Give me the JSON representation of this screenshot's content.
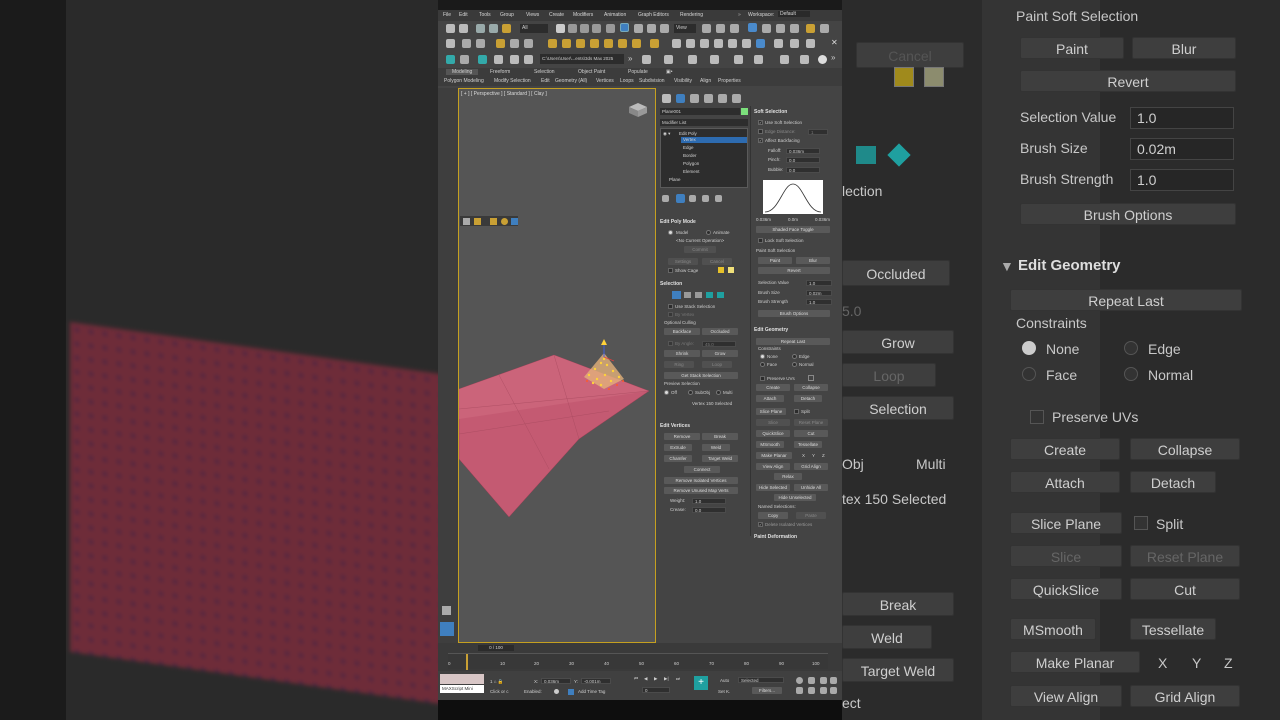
{
  "app": {
    "workspace_label": "Workspace:",
    "workspace_value": "Default",
    "menus": [
      "File",
      "Edit",
      "Tools",
      "Group",
      "Views",
      "Create",
      "Modifiers",
      "Animation",
      "Graph Editors",
      "Rendering"
    ],
    "path": "C:\\Users\\User\\...ents\\3ds Max 2025",
    "view_dropdown": "View",
    "all_dropdown": "All",
    "ribbon_tabs": [
      "Modeling",
      "Freeform",
      "Selection",
      "Object Paint",
      "Populate"
    ],
    "ribbon_sub": [
      "Polygon Modeling",
      "Modify Selection",
      "Edit",
      "Geometry (All)",
      "Vertices",
      "Loops",
      "Subdivision",
      "Visibility",
      "Align",
      "Properties"
    ]
  },
  "viewport": {
    "label": "[ + ] [ Perspective ] [ Standard ] [ Clay ]"
  },
  "modify": {
    "object_name": "Plane001",
    "modifier_list": "Modifier List",
    "stack": [
      "Edit Poly",
      "Vertex",
      "Edge",
      "Border",
      "Polygon",
      "Element",
      "Plane"
    ],
    "edit_poly_mode": {
      "title": "Edit Poly Mode",
      "model": "Model",
      "animate": "Animate",
      "no_op": "<No Current Operation>",
      "commit": "Commit",
      "settings": "Settings",
      "cancel": "Cancel",
      "show_cage": "Show Cage"
    },
    "selection": {
      "title": "Selection",
      "use_stack": "Use Stack Selection",
      "by_vertex": "By Vertex",
      "ignore_backfacing": "Ignore Backfacing",
      "optional_culling": "Optional Culling",
      "backface": "Backface",
      "occluded": "Occluded",
      "by_angle": "By Angle:",
      "by_angle_value": "45.0",
      "shrink": "Shrink",
      "grow": "Grow",
      "ring": "Ring",
      "loop": "Loop",
      "get_stack": "Get Stack Selection",
      "preview": "Preview Selection",
      "off": "Off",
      "subobj": "SubObj",
      "multi": "Multi",
      "status": "Vertex 150 Selected"
    },
    "edit_vertices": {
      "title": "Edit Vertices",
      "remove": "Remove",
      "break": "Break",
      "extrude": "Extrude",
      "weld": "Weld",
      "chamfer": "Chamfer",
      "target_weld": "Target Weld",
      "connect": "Connect",
      "remove_isolated": "Remove Isolated Vertices",
      "remove_unused": "Remove Unused Map Verts",
      "weight_label": "Weight:",
      "weight_value": "1.0",
      "crease_label": "Crease:",
      "crease_value": "0.0"
    },
    "soft_selection": {
      "title": "Soft Selection",
      "use_soft": "Use Soft Selection",
      "edge_distance": "Edge Distance:",
      "edge_distance_value": "1",
      "affect_backfacing": "Affect Backfacing",
      "falloff": "Falloff:",
      "falloff_value": "0.036m",
      "pinch": "Pinch:",
      "pinch_value": "0.0",
      "bubble": "Bubble:",
      "bubble_value": "0.0",
      "curve_left": "0.036m",
      "curve_mid": "0.0m",
      "curve_right": "0.036m",
      "shaded_face": "Shaded Face Toggle",
      "lock": "Lock Soft Selection",
      "paint_title": "Paint Soft Selection",
      "paint": "Paint",
      "blur": "Blur",
      "revert": "Revert",
      "selection_value": "Selection Value",
      "selection_value_num": "1.0",
      "brush_size": "Brush Size",
      "brush_size_val": "0.02m",
      "brush_strength": "Brush Strength",
      "brush_strength_val": "1.0",
      "brush_options": "Brush Options"
    },
    "edit_geometry": {
      "title": "Edit Geometry",
      "repeat_last": "Repeat Last",
      "constraints": "Constraints",
      "none": "None",
      "edge": "Edge",
      "face": "Face",
      "normal": "Normal",
      "preserve_uvs": "Preserve UVs",
      "create": "Create",
      "collapse": "Collapse",
      "attach": "Attach",
      "detach": "Detach",
      "slice_plane": "Slice Plane",
      "split": "Split",
      "slice": "Slice",
      "reset_plane": "Reset Plane",
      "quickslice": "QuickSlice",
      "cut": "Cut",
      "msmooth": "MSmooth",
      "tessellate": "Tessellate",
      "make_planar": "Make Planar",
      "x": "X",
      "y": "Y",
      "z": "Z",
      "view_align": "View Align",
      "grid_align": "Grid Align",
      "relax": "Relax",
      "hide_selected": "Hide Selected",
      "unhide_all": "Unhide All",
      "hide_unselected": "Hide Unselected",
      "named_selections": "Named Selections:",
      "copy": "Copy",
      "paste": "Paste",
      "delete_isolated": "Delete Isolated Vertices"
    },
    "paint_deformation": "Paint Deformation"
  },
  "timeline": {
    "frame_counter": "0 / 100",
    "ticks": [
      "0",
      "10",
      "20",
      "30",
      "40",
      "50",
      "60",
      "70",
      "80",
      "90",
      "100"
    ]
  },
  "status": {
    "maxscript": "MAXScript Mini",
    "click_or": "Click or c",
    "x_label": "X:",
    "x_value": "0.036m",
    "y_label": "Y:",
    "y_value": "-0.001m",
    "enabled": "Enabled:",
    "add_time_tag": "Add Time Tag",
    "auto": "Auto",
    "set_k": "Set K.",
    "selected": "Selected",
    "filters": "Filters..."
  },
  "background_right": {
    "paint_soft_selection": "Paint Soft Selection",
    "paint": "Paint",
    "blur": "Blur",
    "revert": "Revert",
    "selection_value": "Selection Value",
    "selection_value_num": "1.0",
    "brush_size": "Brush Size",
    "brush_size_val": "0.02m",
    "brush_strength": "Brush Strength",
    "brush_strength_val": "1.0",
    "brush_options": "Brush Options",
    "edit_geometry": "Edit Geometry",
    "repeat_last": "Repeat Last",
    "constraints": "Constraints",
    "none": "None",
    "edge": "Edge",
    "face": "Face",
    "normal": "Normal",
    "preserve_uvs": "Preserve UVs",
    "create": "Create",
    "collapse": "Collapse",
    "attach": "Attach",
    "detach": "Detach",
    "slice_plane": "Slice Plane",
    "split": "Split",
    "slice": "Slice",
    "reset_plane": "Reset Plane",
    "quickslice": "QuickSlice",
    "cut": "Cut",
    "msmooth": "MSmooth",
    "tessellate": "Tessellate",
    "make_planar": "Make Planar",
    "x": "X",
    "y": "Y",
    "z": "Z",
    "view_align": "View Align",
    "grid_align": "Grid Align",
    "cancel": "Cancel",
    "occluded": "Occluded",
    "grow": "Grow",
    "loop": "Loop",
    "selection_frag": "Selection",
    "lection_frag": "lection",
    "obj_frag": "Obj",
    "multi": "Multi",
    "vertex_selected_frag": "tex 150 Selected",
    "break": "Break",
    "weld": "Weld",
    "target_weld": "Target Weld",
    "ect_frag": "ect",
    "num_frag": "5.0"
  }
}
